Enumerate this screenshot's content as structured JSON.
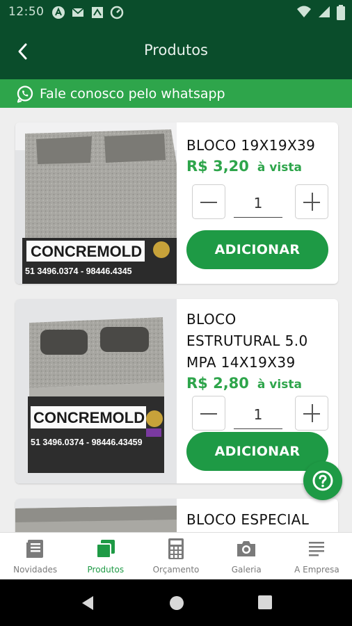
{
  "status_bar": {
    "time": "12:50"
  },
  "app_bar": {
    "title": "Produtos"
  },
  "whatsapp_bar": {
    "label": "Fale conosco pelo whatsapp"
  },
  "products": [
    {
      "name": "BLOCO 19X19X39",
      "price": "R$ 3,20",
      "price_note": "à vista",
      "quantity": "1",
      "add_label": "ADICIONAR",
      "photo_text": "CONCREMOLD",
      "photo_phone": "51 3496.0374 - 98446.4345"
    },
    {
      "name": "BLOCO ESTRUTURAL 5.0 MPA 14X19X39",
      "price": "R$ 2,80",
      "price_note": "à vista",
      "quantity": "1",
      "add_label": "ADICIONAR",
      "photo_text": "CONCREMOLD",
      "photo_phone": "51 3496.0374 - 98446.43459"
    },
    {
      "name": "BLOCO ESPECIAL"
    }
  ],
  "bottom_nav": [
    {
      "label": "Novidades",
      "icon": "news-icon",
      "active": false
    },
    {
      "label": "Produtos",
      "icon": "products-icon",
      "active": true
    },
    {
      "label": "Orçamento",
      "icon": "calculator-icon",
      "active": false
    },
    {
      "label": "Galeria",
      "icon": "camera-icon",
      "active": false
    },
    {
      "label": "A Empresa",
      "icon": "company-icon",
      "active": false
    }
  ],
  "colors": {
    "header": "#0a4d2b",
    "whatsapp_bar": "#2ea54b",
    "accent": "#1e9a45"
  }
}
